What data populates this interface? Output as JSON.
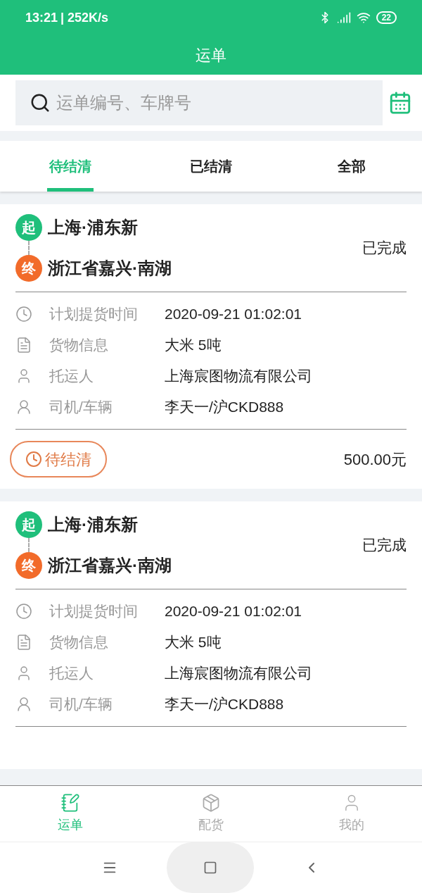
{
  "status_bar": {
    "time": "13:21",
    "speed": "| 252K/s",
    "battery": "22"
  },
  "header": {
    "title": "运单"
  },
  "search": {
    "placeholder": "运单编号、车牌号"
  },
  "tabs": [
    {
      "label": "待结清",
      "selected": true
    },
    {
      "label": "已结清",
      "selected": false
    },
    {
      "label": "全部",
      "selected": false
    }
  ],
  "orders": [
    {
      "origin_badge": "起",
      "origin": "上海·浦东新",
      "dest_badge": "终",
      "destination": "浙江省嘉兴·南湖",
      "status": "已完成",
      "fields": [
        {
          "kind": "time",
          "label": "计划提货时间",
          "value": "2020-09-21 01:02:01"
        },
        {
          "kind": "cargo",
          "label": "货物信息",
          "value": "大米 5吨"
        },
        {
          "kind": "shipper",
          "label": "托运人",
          "value": "上海宸图物流有限公司"
        },
        {
          "kind": "driver",
          "label": "司机/车辆",
          "value": "李天一/沪CKD888"
        }
      ],
      "footer": {
        "badge": "待结清",
        "amount": "500.00元"
      }
    },
    {
      "origin_badge": "起",
      "origin": "上海·浦东新",
      "dest_badge": "终",
      "destination": "浙江省嘉兴·南湖",
      "status": "已完成",
      "fields": [
        {
          "kind": "time",
          "label": "计划提货时间",
          "value": "2020-09-21 01:02:01"
        },
        {
          "kind": "cargo",
          "label": "货物信息",
          "value": "大米 5吨"
        },
        {
          "kind": "shipper",
          "label": "托运人",
          "value": "上海宸图物流有限公司"
        },
        {
          "kind": "driver",
          "label": "司机/车辆",
          "value": "李天一/沪CKD888"
        }
      ]
    }
  ],
  "bottom_nav": [
    {
      "kind": "orders",
      "label": "运单",
      "selected": true
    },
    {
      "kind": "cargo",
      "label": "配货",
      "selected": false
    },
    {
      "kind": "me",
      "label": "我的",
      "selected": false
    }
  ]
}
